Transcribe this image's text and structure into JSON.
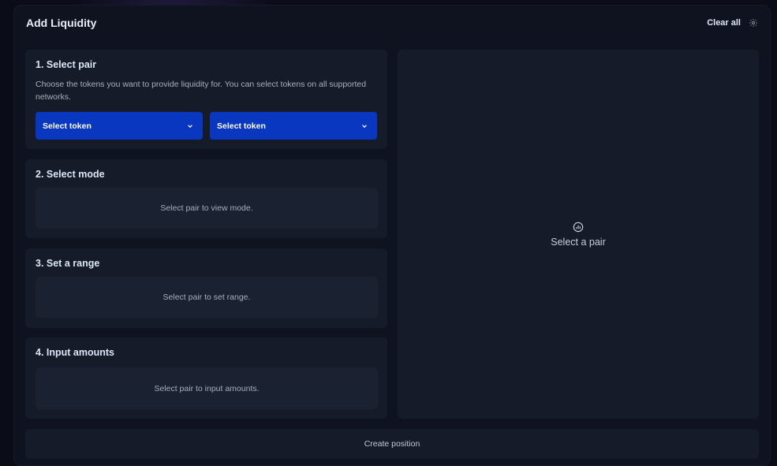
{
  "header": {
    "title": "Add Liquidity",
    "clear_all": "Clear all",
    "settings_icon": "gear-icon"
  },
  "step1": {
    "title": "1. Select pair",
    "description": "Choose the tokens you want to provide liquidity for. You can select tokens on all supported networks.",
    "token_a_label": "Select token",
    "token_b_label": "Select token"
  },
  "step2": {
    "title": "2. Select mode",
    "placeholder": "Select pair to view mode."
  },
  "step3": {
    "title": "3. Set a range",
    "placeholder": "Select pair to set range."
  },
  "step4": {
    "title": "4. Input amounts",
    "placeholder": "Select pair to input amounts."
  },
  "preview": {
    "icon": "chart-icon",
    "text": "Select a pair"
  },
  "footer": {
    "create_label": "Create position"
  },
  "colors": {
    "accent": "#0937c0",
    "card": "#151b29",
    "background": "#0f1320"
  }
}
